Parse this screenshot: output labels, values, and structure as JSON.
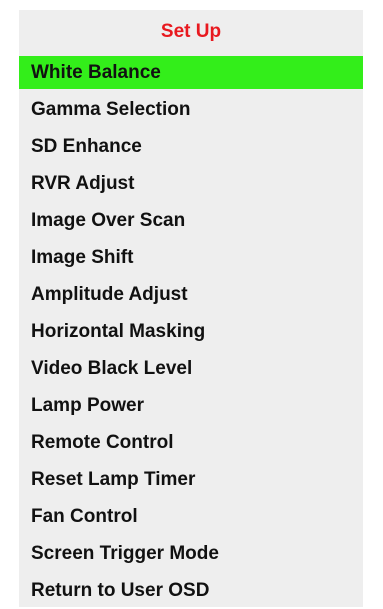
{
  "menu": {
    "title": "Set Up",
    "selected_index": 0,
    "items": [
      {
        "label": "White Balance"
      },
      {
        "label": "Gamma Selection"
      },
      {
        "label": "SD Enhance"
      },
      {
        "label": "RVR Adjust"
      },
      {
        "label": "Image Over Scan"
      },
      {
        "label": "Image Shift"
      },
      {
        "label": "Amplitude Adjust"
      },
      {
        "label": "Horizontal Masking"
      },
      {
        "label": "Video Black Level"
      },
      {
        "label": "Lamp Power"
      },
      {
        "label": "Remote Control"
      },
      {
        "label": "Reset Lamp Timer"
      },
      {
        "label": "Fan Control"
      },
      {
        "label": "Screen Trigger Mode"
      },
      {
        "label": "Return to User OSD"
      }
    ]
  },
  "colors": {
    "title": "#e8191f",
    "highlight": "#33ee1a",
    "panel_bg": "#eeeeee",
    "text": "#111111"
  }
}
